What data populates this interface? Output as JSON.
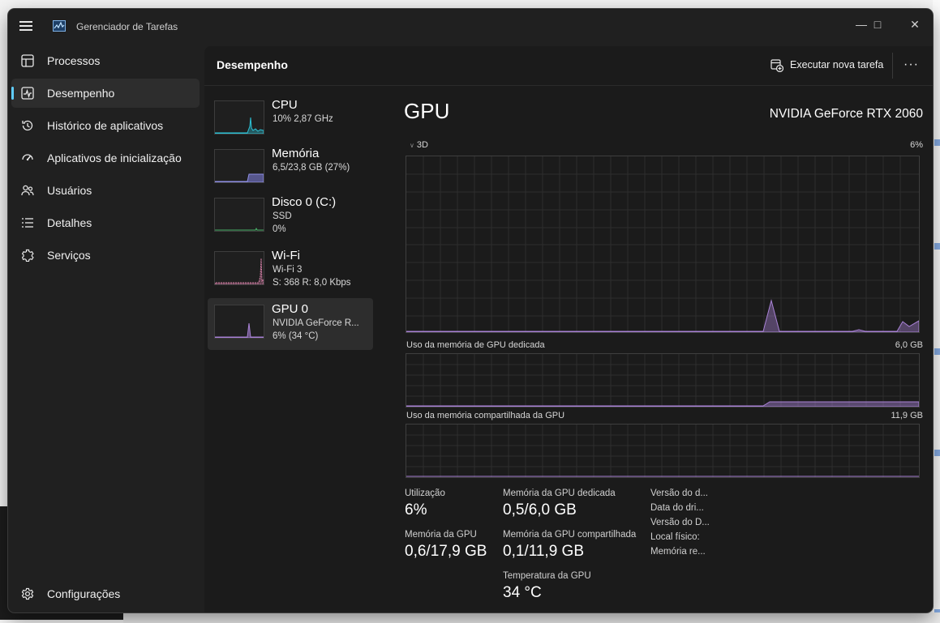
{
  "app": {
    "title": "Gerenciador de Tarefas"
  },
  "nav": {
    "items": [
      {
        "label": "Processos",
        "icon": "processes-icon"
      },
      {
        "label": "Desempenho",
        "icon": "performance-icon",
        "active": true
      },
      {
        "label": "Histórico de aplicativos",
        "icon": "history-icon"
      },
      {
        "label": "Aplicativos de inicialização",
        "icon": "startup-icon"
      },
      {
        "label": "Usuários",
        "icon": "users-icon"
      },
      {
        "label": "Detalhes",
        "icon": "details-icon"
      },
      {
        "label": "Serviços",
        "icon": "services-icon"
      }
    ],
    "settings_label": "Configurações"
  },
  "header": {
    "title": "Desempenho",
    "run_task_label": "Executar nova tarefa",
    "more_label": "···"
  },
  "resources": [
    {
      "name": "CPU",
      "line1": "10%  2,87 GHz",
      "line2": "",
      "color": "#2cc3d7"
    },
    {
      "name": "Memória",
      "line1": "6,5/23,8 GB (27%)",
      "line2": "",
      "color": "#7b7bd6"
    },
    {
      "name": "Disco 0 (C:)",
      "line1": "SSD",
      "line2": "0%",
      "color": "#4ab36a"
    },
    {
      "name": "Wi-Fi",
      "line1": "Wi-Fi 3",
      "line2": "S: 368  R: 8,0 Kbps",
      "color": "#d47fa6"
    },
    {
      "name": "GPU 0",
      "line1": "NVIDIA GeForce R...",
      "line2": "6%  (34 °C)",
      "color": "#a982d6",
      "selected": true
    }
  ],
  "gpu": {
    "title": "GPU",
    "model": "NVIDIA GeForce RTX 2060",
    "engine_label": "3D",
    "engine_max": "6%",
    "dedicated_label": "Uso da memória de GPU dedicada",
    "dedicated_max": "6,0 GB",
    "shared_label": "Uso da memória compartilhada da GPU",
    "shared_max": "11,9 GB",
    "stats": {
      "utilization_label": "Utilização",
      "utilization_value": "6%",
      "dedicated_mem_label": "Memória da GPU dedicada",
      "dedicated_mem_value": "0,5/6,0 GB",
      "gpu_mem_label": "Memória da GPU",
      "gpu_mem_value": "0,6/17,9 GB",
      "shared_mem_label": "Memória da GPU compartilhada",
      "shared_mem_value": "0,1/11,9 GB",
      "temp_label": "Temperatura da GPU",
      "temp_value": "34 °C"
    },
    "info_labels": [
      "Versão do d...",
      "Data do dri...",
      "Versão do D...",
      "Local físico:",
      "Memória re..."
    ]
  },
  "colors": {
    "accent": "#60cdff",
    "gpu": "#a982d6"
  }
}
